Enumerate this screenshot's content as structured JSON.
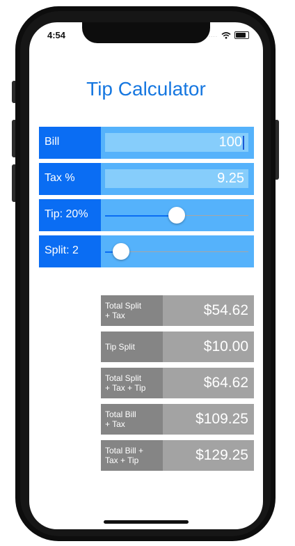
{
  "status": {
    "time": "4:54",
    "signal": "...."
  },
  "app": {
    "title": "Tip Calculator"
  },
  "inputs": {
    "bill": {
      "label": "Bill",
      "value": "100"
    },
    "tax": {
      "label": "Tax %",
      "value": "9.25"
    },
    "tip": {
      "label": "Tip: 20%",
      "fraction": 0.5
    },
    "split": {
      "label": "Split: 2",
      "fraction": 0.11
    }
  },
  "results": [
    {
      "label": "Total Split\n+ Tax",
      "value": "$54.62"
    },
    {
      "label": "Tip Split",
      "value": "$10.00"
    },
    {
      "label": "Total Split\n+ Tax + Tip",
      "value": "$64.62"
    },
    {
      "label": "Total Bill\n+ Tax",
      "value": "$109.25"
    },
    {
      "label": "Total Bill +\nTax + Tip",
      "value": "$129.25"
    }
  ],
  "colors": {
    "accent": "#0a6df3",
    "panel": "#55b2fb",
    "field": "#86cdfb",
    "result_bg": "#a3a3a3",
    "result_label_bg": "#858585",
    "title": "#1677e0"
  },
  "icons": [
    "wifi-icon",
    "battery-icon"
  ]
}
